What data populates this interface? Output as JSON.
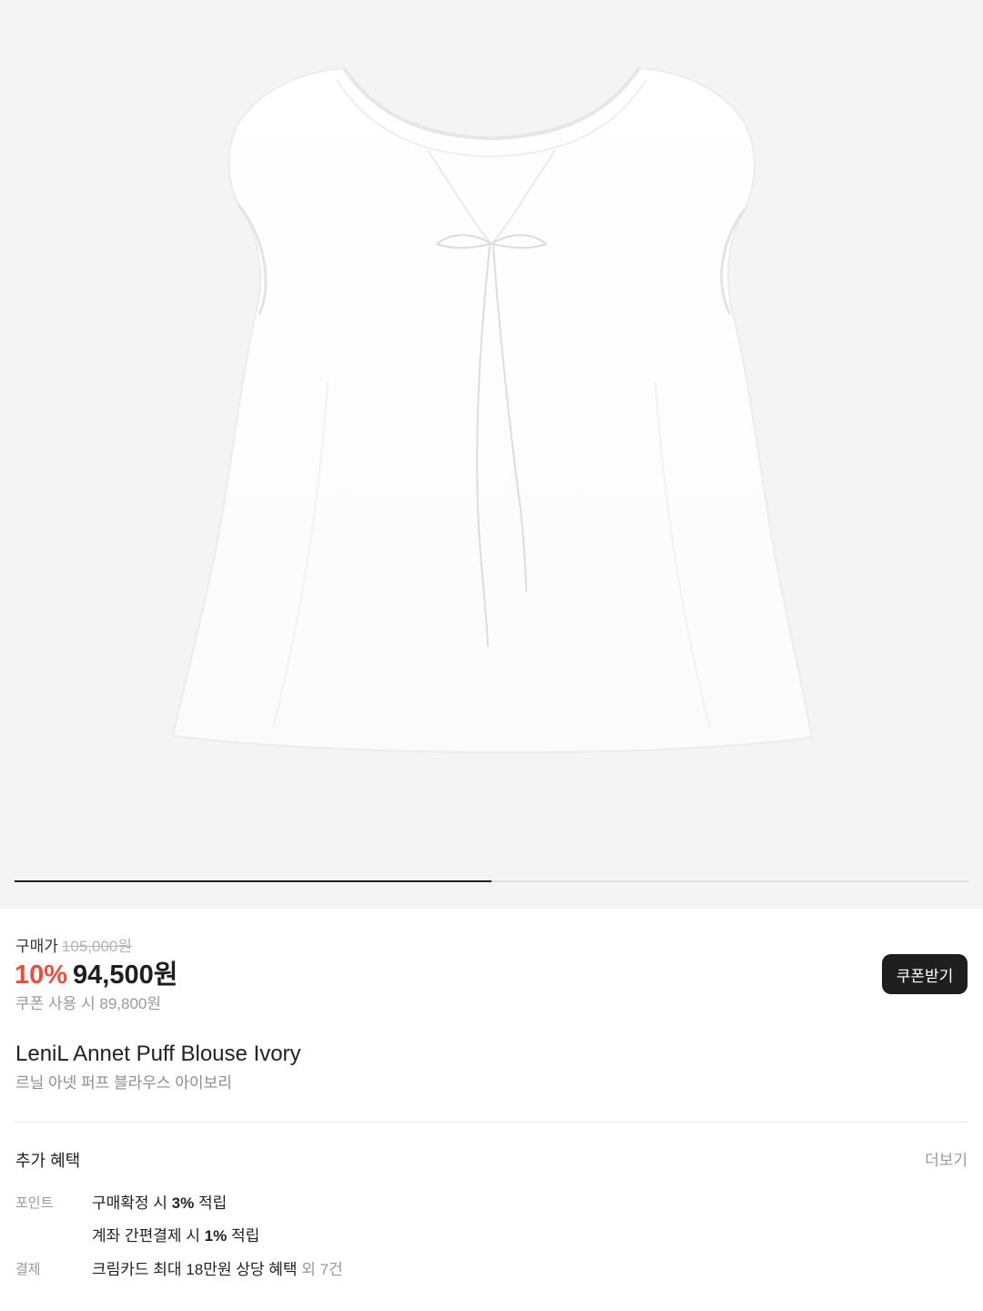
{
  "gallery": {
    "image_alt": "product-photo",
    "slide_progress": 0.5
  },
  "price": {
    "label": "구매가",
    "original": "105,000원",
    "discount": "10%",
    "sale": "94,500원",
    "coupon_text": "쿠폰 사용 시 89,800원",
    "coupon_button": "쿠폰받기"
  },
  "product": {
    "name_en": "LeniL Annet Puff Blouse Ivory",
    "name_ko": "르닐 아넷 퍼프 블라우스 아이보리"
  },
  "benefits": {
    "title": "추가 혜택",
    "more": "더보기",
    "point_label": "포인트",
    "point_1": {
      "pre": "구매확정 시 ",
      "bold": "3%",
      "post": " 적립"
    },
    "point_2": {
      "pre": "계좌 간편결제 시 ",
      "bold": "1%",
      "post": " 적립"
    },
    "payment_label": "결제",
    "payment_1": {
      "text": "크림카드 최대 18만원 상당 혜택",
      "muted": " 외 7건"
    }
  },
  "colors": {
    "discount": "#ef4c3c",
    "button_bg": "#1e1e1e",
    "gallery_bg": "#f4f4f4"
  }
}
